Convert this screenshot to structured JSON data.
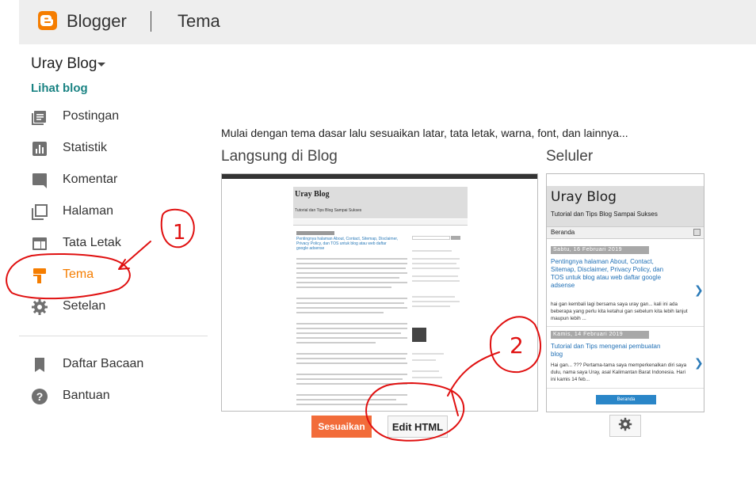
{
  "header": {
    "brand": "Blogger",
    "page_title": "Tema",
    "brand_color": "#f57d00"
  },
  "sidebar": {
    "blog_name": "Uray Blog",
    "view_blog": "Lihat blog",
    "items": [
      {
        "label": "Postingan",
        "icon": "posts-icon"
      },
      {
        "label": "Statistik",
        "icon": "stats-icon"
      },
      {
        "label": "Komentar",
        "icon": "comments-icon"
      },
      {
        "label": "Halaman",
        "icon": "pages-icon"
      },
      {
        "label": "Tata Letak",
        "icon": "layout-icon"
      },
      {
        "label": "Tema",
        "icon": "paint-roller-icon",
        "active": true
      },
      {
        "label": "Setelan",
        "icon": "gear-icon"
      }
    ],
    "secondary": [
      {
        "label": "Daftar Bacaan",
        "icon": "bookmark-icon"
      },
      {
        "label": "Bantuan",
        "icon": "help-icon"
      }
    ]
  },
  "main": {
    "intro": "Mulai dengan tema dasar lalu sesuaikan latar, tata letak, warna, font, dan lainnya...",
    "desktop_title": "Langsung di Blog",
    "mobile_title": "Seluler",
    "customize_label": "Sesuaikan",
    "edit_html_label": "Edit HTML",
    "accent_color": "#f26c3a"
  },
  "preview": {
    "blog_title": "Uray Blog",
    "tagline": "Tutorial dan Tips Blog Sampai Sukses",
    "desktop_post_title": "Pentingnya halaman About, Contact, Sitemap, Disclaimer, Privacy Policy, dan TOS untuk blog atau web daftar google adsense",
    "mobile_menu": "Beranda",
    "posts": [
      {
        "date": "Sabtu, 16 Februari 2019",
        "title": "Pentingnya halaman About, Contact, Sitemap, Disclaimer, Privacy Policy, dan TOS untuk blog atau web daftar google adsense",
        "excerpt": "hai gan kembali lagi bersama saya uray gan... kali ini ada beberapa yang perlu kita ketahui gan sebelum kita lebih lanjut maupun lebih ..."
      },
      {
        "date": "Kamis, 14 Februari 2019",
        "title": "Tutorial dan Tips mengenai pembuatan blog",
        "excerpt": "Hai gan... ??? Pertama-tama saya memperkenalkan diri saya dulu, nama saya Uray, asal Kalimantan Barat Indonesia. Hari ini kamis 14 feb..."
      }
    ],
    "home_button": "Beranda"
  },
  "annotations": {
    "mark_1": "1",
    "mark_2": "2"
  }
}
